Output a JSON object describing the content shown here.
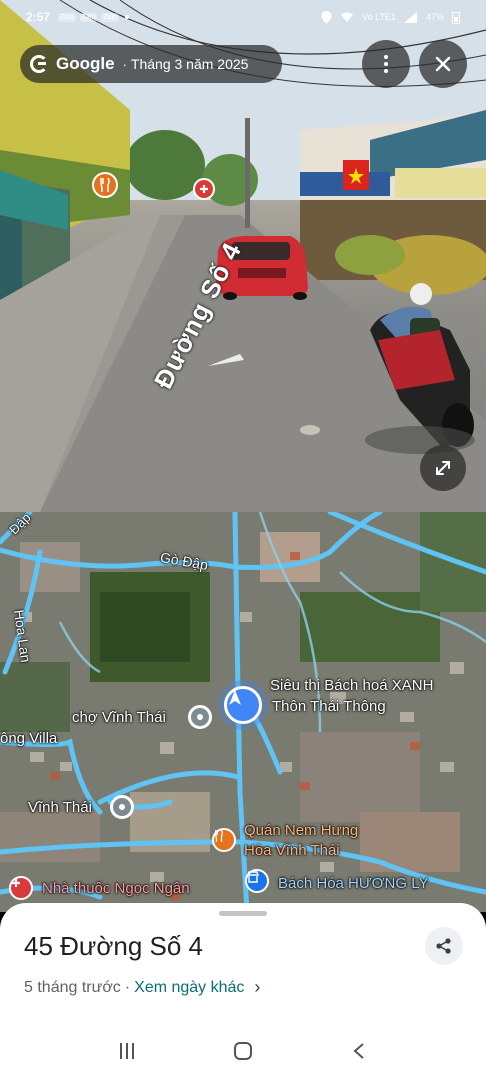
{
  "status_bar": {
    "time": "2:57",
    "app_badges": [
      "Zalo",
      "Zalo",
      "Zalo"
    ],
    "network": "Vo LTE1",
    "battery": "47%"
  },
  "street_view": {
    "brand": "Google",
    "capture_date": "Tháng 3 năm 2025",
    "street_name": "Đường Số 4",
    "icons": [
      "google-g-icon",
      "more-vert-icon",
      "close-icon",
      "expand-icon",
      "restaurant-icon",
      "pharmacy-icon",
      "nav-chevron-icon"
    ]
  },
  "map": {
    "labels": {
      "go_dap_street": "Gò Đập",
      "dap_street": "Đập",
      "hoa_lan": "Hoa Lan",
      "sieu_thi": "Siêu thị Bách hoá XANH",
      "thon": "Thôn Thái Thông",
      "cho": "chợ Vĩnh Thái",
      "villa": "ông Villa",
      "vinh_thai": "Vĩnh Thái",
      "quan_nem_1": "Quán Nem Hưng",
      "quan_nem_2": "Hòa Vĩnh Thái",
      "nha_thuoc": "Nhà thuốc Ngọc Ngân",
      "bach_hoa": "Bách Hóa HƯƠNG LY"
    },
    "colors": {
      "road": "#5fc4f3",
      "you": "#4285f4",
      "food": "#e8711c",
      "pharmacy": "#d93b3b"
    }
  },
  "sheet": {
    "address": "45 Đường Số 4",
    "age": "5 tháng trước",
    "separator": "·",
    "other_dates_link": "Xem ngày khác"
  }
}
